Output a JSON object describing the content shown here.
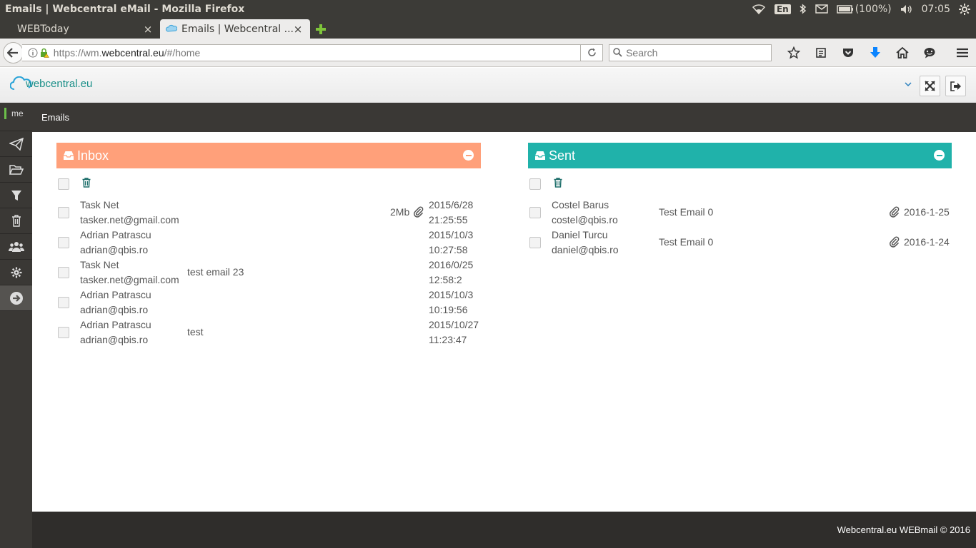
{
  "os": {
    "window_title": "Emails | Webcentral eMail - Mozilla Firefox",
    "keyboard": "En",
    "battery": "(100%)",
    "time": "07:05"
  },
  "browser": {
    "tabs": [
      {
        "label": "WEBToday",
        "close": "×"
      },
      {
        "label": "Emails | Webcentral ...",
        "close": "×"
      }
    ],
    "url_prefix": "https://wm.",
    "url_host": "webcentral.eu",
    "url_suffix": "/#/home",
    "search_placeholder": "Search"
  },
  "app": {
    "logo_text": "webcentral.eu",
    "caret": "⌄",
    "sidebar_user": "me",
    "section_title": "Emails",
    "footer": "Webcentral.eu WEBmail © 2016"
  },
  "inbox": {
    "title": "Inbox",
    "rows": [
      {
        "name": "Task Net",
        "email": "tasker.net@gmail.com",
        "subject": "",
        "size": "2Mb",
        "attachment": true,
        "date": "2015/6/28",
        "time": "21:25:55"
      },
      {
        "name": "Adrian Patrascu",
        "email": "adrian@qbis.ro",
        "subject": "",
        "size": "",
        "attachment": false,
        "date": "2015/10/3",
        "time": "10:27:58"
      },
      {
        "name": "Task Net",
        "email": "tasker.net@gmail.com",
        "subject": "test email 23",
        "size": "",
        "attachment": false,
        "date": "2016/0/25",
        "time": "12:58:2"
      },
      {
        "name": "Adrian Patrascu",
        "email": "adrian@qbis.ro",
        "subject": "",
        "size": "",
        "attachment": false,
        "date": "2015/10/3",
        "time": "10:19:56"
      },
      {
        "name": "Adrian Patrascu",
        "email": "adrian@qbis.ro",
        "subject": "test",
        "size": "",
        "attachment": false,
        "date": "2015/10/27",
        "time": "11:23:47"
      }
    ]
  },
  "sent": {
    "title": "Sent",
    "rows": [
      {
        "name": "Costel Barus",
        "email": "costel@qbis.ro",
        "subject": "Test Email 0",
        "attachment": true,
        "date": "2016-1-25"
      },
      {
        "name": "Daniel Turcu",
        "email": "daniel@qbis.ro",
        "subject": "Test Email 0",
        "attachment": true,
        "date": "2016-1-24"
      }
    ]
  },
  "colors": {
    "inbox_header": "#ffa07a",
    "sent_header": "#20b2aa",
    "sidebar": "#3a3835",
    "footer": "#2f2d2b"
  }
}
